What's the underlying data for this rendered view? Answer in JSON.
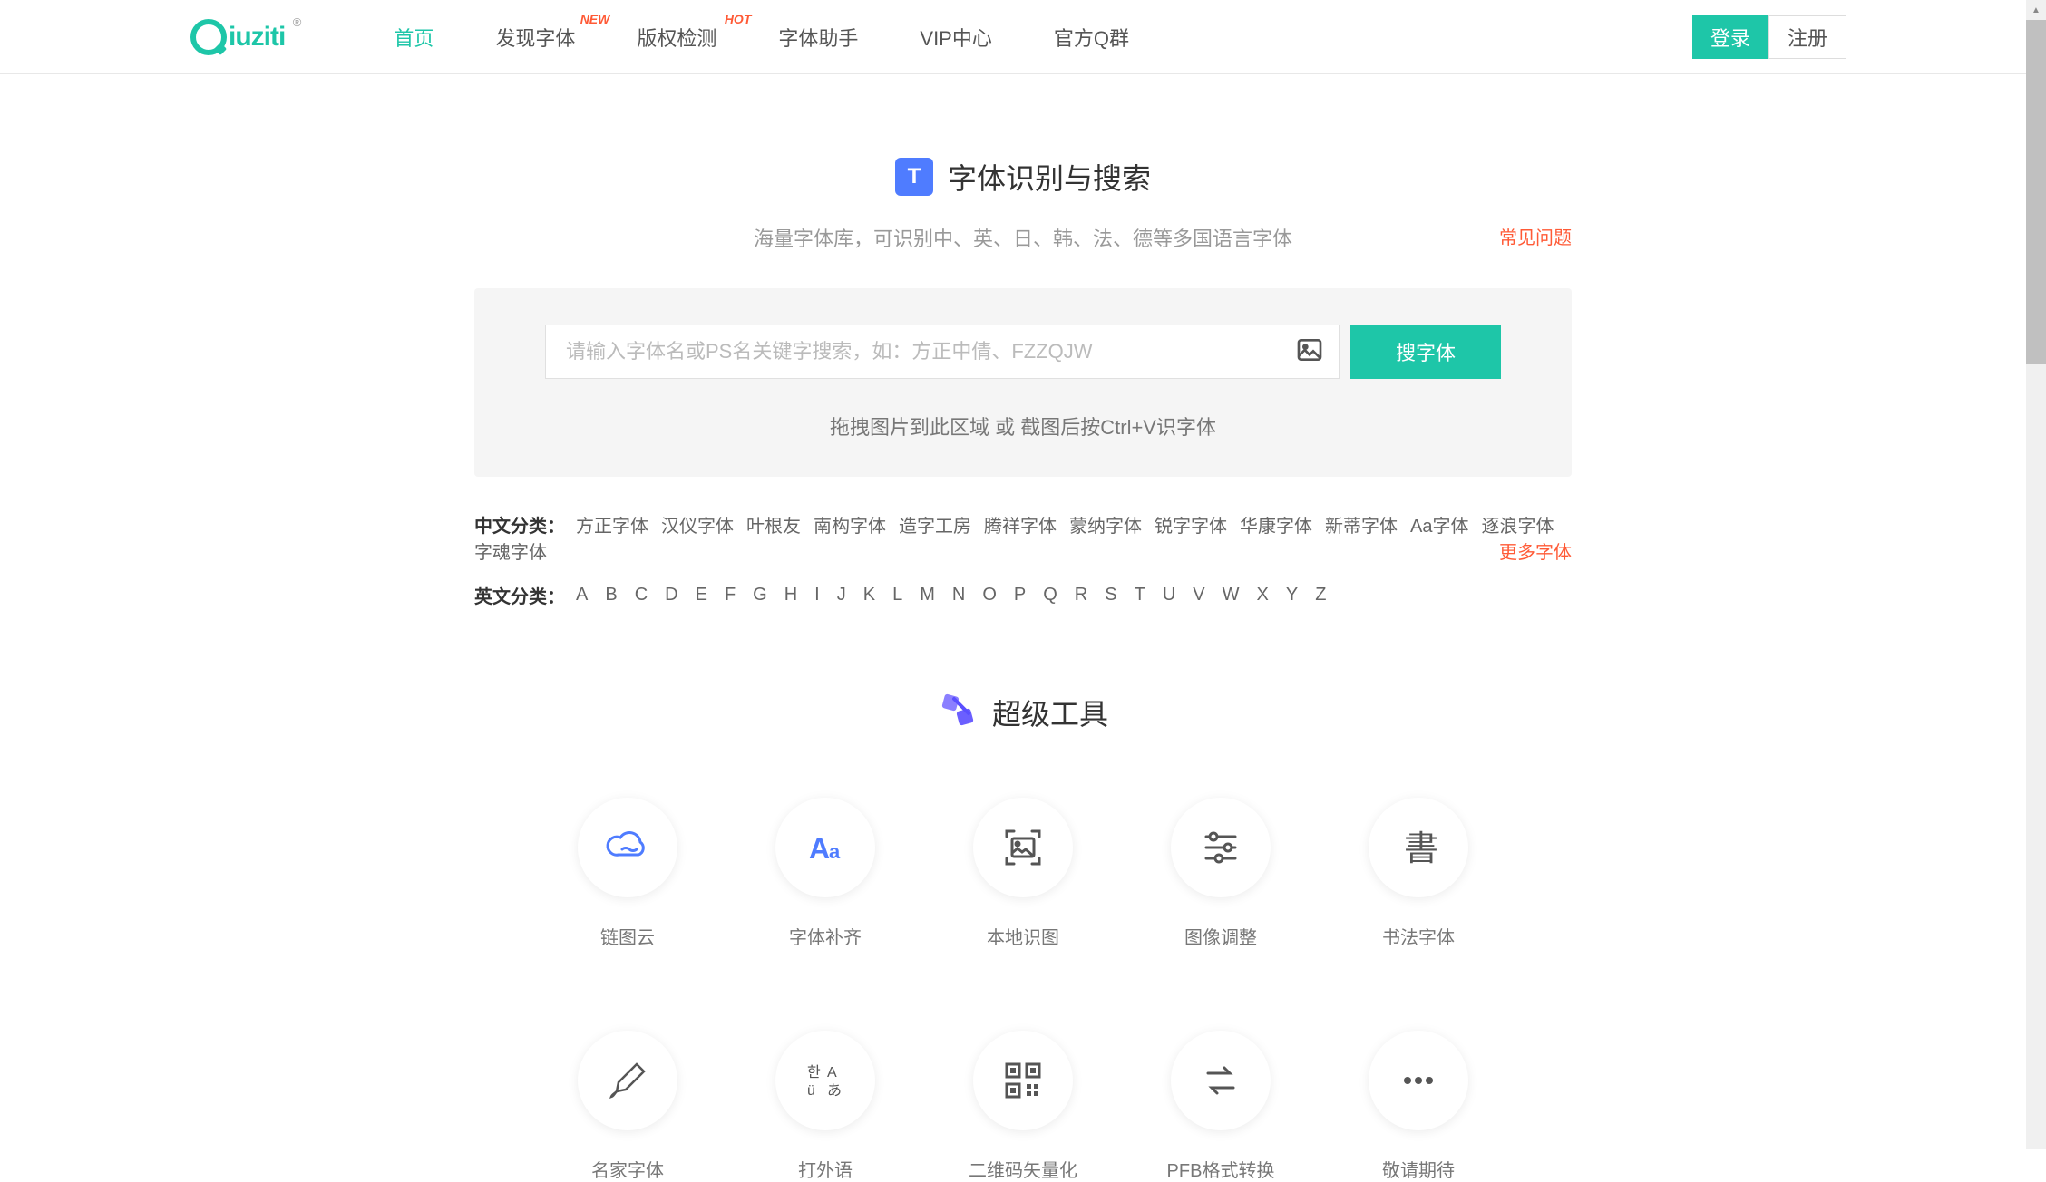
{
  "logo": {
    "text": "iuziti",
    "trademark": "®"
  },
  "nav": {
    "items": [
      {
        "label": "首页",
        "active": true
      },
      {
        "label": "发现字体",
        "badge": "NEW"
      },
      {
        "label": "版权检测",
        "badge": "HOT"
      },
      {
        "label": "字体助手"
      },
      {
        "label": "VIP中心"
      },
      {
        "label": "官方Q群"
      }
    ]
  },
  "auth": {
    "login": "登录",
    "register": "注册"
  },
  "hero": {
    "icon_text": "T",
    "title": "字体识别与搜索",
    "subtitle": "海量字体库，可识别中、英、日、韩、法、德等多国语言字体",
    "faq": "常见问题"
  },
  "search": {
    "placeholder": "请输入字体名或PS名关键字搜索，如：方正中倩、FZZQJW",
    "button": "搜字体",
    "drag_hint": "拖拽图片到此区域 或 截图后按Ctrl+V识字体"
  },
  "categories": {
    "chinese_label": "中文分类：",
    "chinese_items": [
      "方正字体",
      "汉仪字体",
      "叶根友",
      "南构字体",
      "造字工房",
      "腾祥字体",
      "蒙纳字体",
      "锐字字体",
      "华康字体",
      "新蒂字体",
      "Aa字体",
      "逐浪字体",
      "字魂字体"
    ],
    "more": "更多字体",
    "english_label": "英文分类：",
    "english_items": [
      "A",
      "B",
      "C",
      "D",
      "E",
      "F",
      "G",
      "H",
      "I",
      "J",
      "K",
      "L",
      "M",
      "N",
      "O",
      "P",
      "Q",
      "R",
      "S",
      "T",
      "U",
      "V",
      "W",
      "X",
      "Y",
      "Z"
    ]
  },
  "tools": {
    "title": "超级工具",
    "items": [
      {
        "label": "链图云",
        "icon": "cloud"
      },
      {
        "label": "字体补齐",
        "icon": "aa"
      },
      {
        "label": "本地识图",
        "icon": "scan"
      },
      {
        "label": "图像调整",
        "icon": "sliders"
      },
      {
        "label": "书法字体",
        "icon": "shu"
      },
      {
        "label": "名家字体",
        "icon": "brush"
      },
      {
        "label": "打外语",
        "icon": "lang"
      },
      {
        "label": "二维码矢量化",
        "icon": "qr"
      },
      {
        "label": "PFB格式转换",
        "icon": "convert"
      },
      {
        "label": "敬请期待",
        "icon": "dots"
      }
    ]
  }
}
